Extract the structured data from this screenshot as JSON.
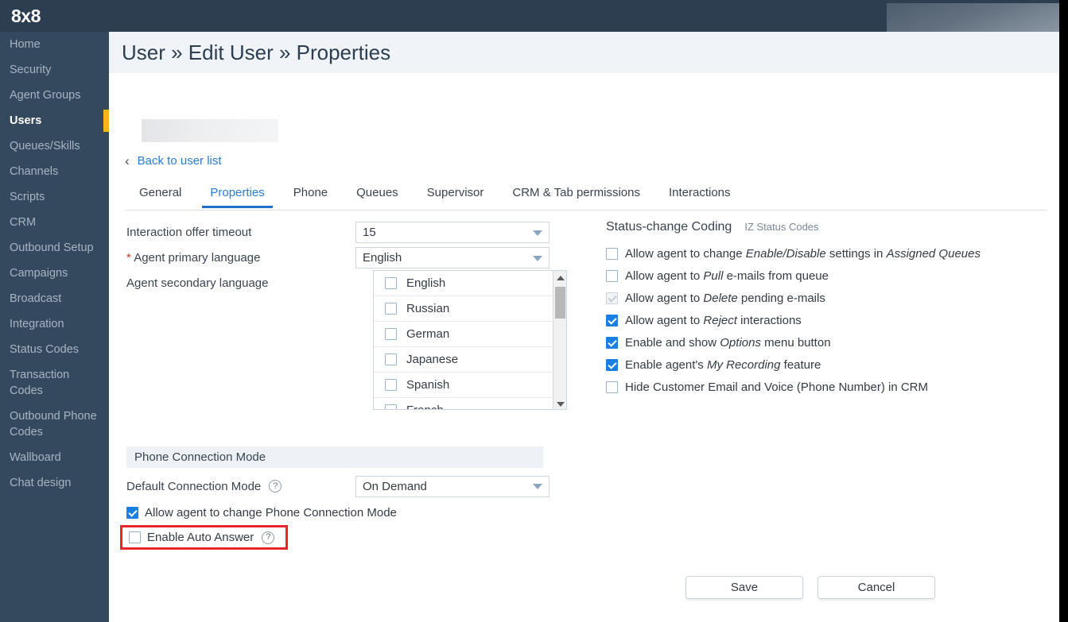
{
  "brand": {
    "logo": "8x8"
  },
  "sidebar": {
    "items": [
      {
        "label": "Home",
        "active": false
      },
      {
        "label": "Security",
        "active": false
      },
      {
        "label": "Agent Groups",
        "active": false
      },
      {
        "label": "Users",
        "active": true
      },
      {
        "label": "Queues/Skills",
        "active": false
      },
      {
        "label": "Channels",
        "active": false
      },
      {
        "label": "Scripts",
        "active": false
      },
      {
        "label": "CRM",
        "active": false
      },
      {
        "label": "Outbound Setup",
        "active": false
      },
      {
        "label": "Campaigns",
        "active": false
      },
      {
        "label": "Broadcast",
        "active": false
      },
      {
        "label": "Integration",
        "active": false
      },
      {
        "label": "Status Codes",
        "active": false
      },
      {
        "label": "Transaction Codes",
        "active": false
      },
      {
        "label": "Outbound Phone Codes",
        "active": false
      },
      {
        "label": "Wallboard",
        "active": false
      },
      {
        "label": "Chat design",
        "active": false
      }
    ]
  },
  "header": {
    "title": "User » Edit User » Properties"
  },
  "back_link": {
    "label": "Back to user list",
    "icon": "chevron-left-icon",
    "chevron": "‹"
  },
  "tabs": [
    {
      "label": "General",
      "active": false
    },
    {
      "label": "Properties",
      "active": true
    },
    {
      "label": "Phone",
      "active": false
    },
    {
      "label": "Queues",
      "active": false
    },
    {
      "label": "Supervisor",
      "active": false
    },
    {
      "label": "CRM & Tab permissions",
      "active": false
    },
    {
      "label": "Interactions",
      "active": false
    }
  ],
  "form": {
    "interaction_offer_timeout": {
      "label": "Interaction offer timeout",
      "value": "15"
    },
    "agent_primary_language": {
      "label": "Agent primary language",
      "required_marker": "*",
      "value": "English"
    },
    "agent_secondary_language": {
      "label": "Agent secondary language",
      "options": [
        {
          "label": "English",
          "checked": false
        },
        {
          "label": "Russian",
          "checked": false
        },
        {
          "label": "German",
          "checked": false
        },
        {
          "label": "Japanese",
          "checked": false
        },
        {
          "label": "Spanish",
          "checked": false
        },
        {
          "label": "French",
          "checked": false
        }
      ]
    }
  },
  "status_change_coding": {
    "title": "Status-change Coding",
    "link": "IZ Status Codes",
    "permissions": [
      {
        "text_parts": [
          {
            "t": "Allow agent to change ",
            "i": false
          },
          {
            "t": "Enable/Disable",
            "i": true
          },
          {
            "t": " settings in ",
            "i": false
          },
          {
            "t": "Assigned Queues",
            "i": true
          }
        ],
        "plain": "Allow agent to change Enable/Disable settings in Assigned Queues",
        "state": "unchecked"
      },
      {
        "text_parts": [
          {
            "t": "Allow agent to ",
            "i": false
          },
          {
            "t": "Pull",
            "i": true
          },
          {
            "t": " e-mails from queue",
            "i": false
          }
        ],
        "plain": "Allow agent to Pull e-mails from queue",
        "state": "unchecked"
      },
      {
        "text_parts": [
          {
            "t": "Allow agent to ",
            "i": false
          },
          {
            "t": "Delete",
            "i": true
          },
          {
            "t": " pending e-mails",
            "i": false
          }
        ],
        "plain": "Allow agent to Delete pending e-mails",
        "state": "disabled-checked"
      },
      {
        "text_parts": [
          {
            "t": "Allow agent to ",
            "i": false
          },
          {
            "t": "Reject",
            "i": true
          },
          {
            "t": " interactions",
            "i": false
          }
        ],
        "plain": "Allow agent to Reject interactions",
        "state": "checked"
      },
      {
        "text_parts": [
          {
            "t": "Enable and show ",
            "i": false
          },
          {
            "t": "Options",
            "i": true
          },
          {
            "t": " menu button",
            "i": false
          }
        ],
        "plain": "Enable and show Options menu button",
        "state": "checked"
      },
      {
        "text_parts": [
          {
            "t": "Enable agent's ",
            "i": false
          },
          {
            "t": "My Recording",
            "i": true
          },
          {
            "t": " feature",
            "i": false
          }
        ],
        "plain": "Enable agent's My Recording feature",
        "state": "checked"
      },
      {
        "text_parts": [
          {
            "t": "Hide Customer Email and Voice (Phone Number) in CRM",
            "i": false
          }
        ],
        "plain": "Hide Customer Email and Voice (Phone Number) in CRM",
        "state": "unchecked"
      }
    ]
  },
  "phone_connection_mode": {
    "section_title": "Phone Connection Mode",
    "default_connection_mode": {
      "label": "Default Connection Mode",
      "help_icon": "help-question-icon",
      "help_glyph": "?",
      "value": "On Demand"
    },
    "allow_change": {
      "label": "Allow agent to change Phone Connection Mode",
      "checked": true
    },
    "enable_auto_answer": {
      "label": "Enable Auto Answer",
      "help_icon": "help-question-icon",
      "help_glyph": "?",
      "checked": false,
      "highlighted": true,
      "highlight_color": "#e8262b"
    }
  },
  "footer": {
    "save_label": "Save",
    "cancel_label": "Cancel"
  },
  "colors": {
    "sidebar_bg": "#34495e",
    "topbar_bg": "#2c3e50",
    "accent_blue": "#2b7cd3",
    "active_marker": "#fdb515",
    "checkbox_checked": "#1a7fe0",
    "highlight_red": "#e8262b",
    "title_bar_bg": "#f0f3f7"
  }
}
